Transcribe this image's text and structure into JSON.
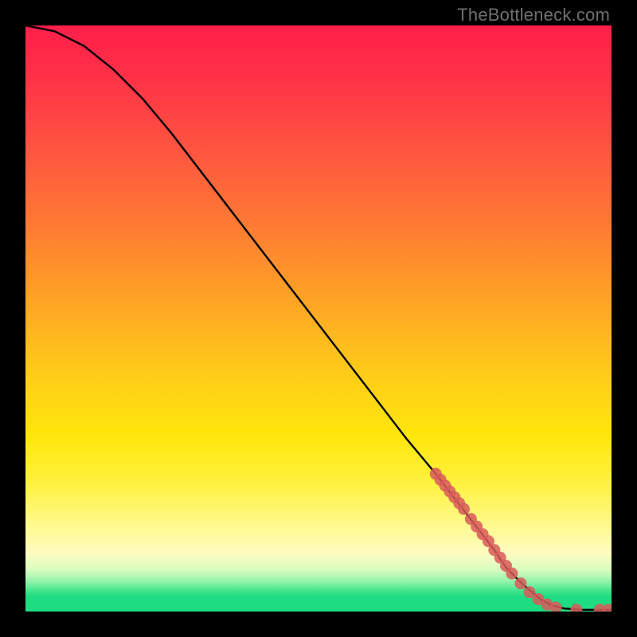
{
  "attribution": "TheBottleneck.com",
  "chart_data": {
    "type": "line",
    "title": "",
    "xlabel": "",
    "ylabel": "",
    "xlim": [
      0,
      100
    ],
    "ylim": [
      0,
      100
    ],
    "note": "Axes are unlabeled in the image; values are normalized 0–100 estimated from pixel position.",
    "series": [
      {
        "name": "curve",
        "color": "#000000",
        "x": [
          0,
          5,
          10,
          15,
          20,
          25,
          30,
          35,
          40,
          45,
          50,
          55,
          60,
          65,
          70,
          75,
          80,
          82,
          85,
          88,
          90,
          92,
          95,
          98,
          100
        ],
        "y": [
          100,
          99,
          96.5,
          92.5,
          87.5,
          81.5,
          75,
          68.5,
          62,
          55.5,
          49,
          42.5,
          36,
          29.5,
          23.5,
          17,
          10.5,
          7.5,
          4.5,
          2,
          1,
          0.5,
          0.3,
          0.3,
          0.3
        ]
      },
      {
        "name": "markers",
        "type": "scatter",
        "color": "#d85a5a",
        "x": [
          70,
          70.8,
          71.6,
          72.4,
          73.2,
          74,
          74.8,
          76,
          77,
          78,
          79,
          80,
          81,
          82,
          83,
          84.5,
          86,
          87.5,
          89,
          90.5,
          94,
          98,
          99.5
        ],
        "y": [
          23.5,
          22.5,
          21.5,
          20.5,
          19.5,
          18.5,
          17.5,
          15.8,
          14.5,
          13.2,
          12,
          10.5,
          9.2,
          7.8,
          6.5,
          4.8,
          3.3,
          2.1,
          1.2,
          0.7,
          0.3,
          0.3,
          0.3
        ]
      }
    ],
    "gradient_stops": [
      {
        "pos": 0.0,
        "color": "#ff1f4a"
      },
      {
        "pos": 0.22,
        "color": "#ff5740"
      },
      {
        "pos": 0.44,
        "color": "#ff9a28"
      },
      {
        "pos": 0.62,
        "color": "#ffd216"
      },
      {
        "pos": 0.78,
        "color": "#fff23e"
      },
      {
        "pos": 0.9,
        "color": "#fffcc0"
      },
      {
        "pos": 0.95,
        "color": "#8df2a8"
      },
      {
        "pos": 1.0,
        "color": "#1edc82"
      }
    ]
  }
}
